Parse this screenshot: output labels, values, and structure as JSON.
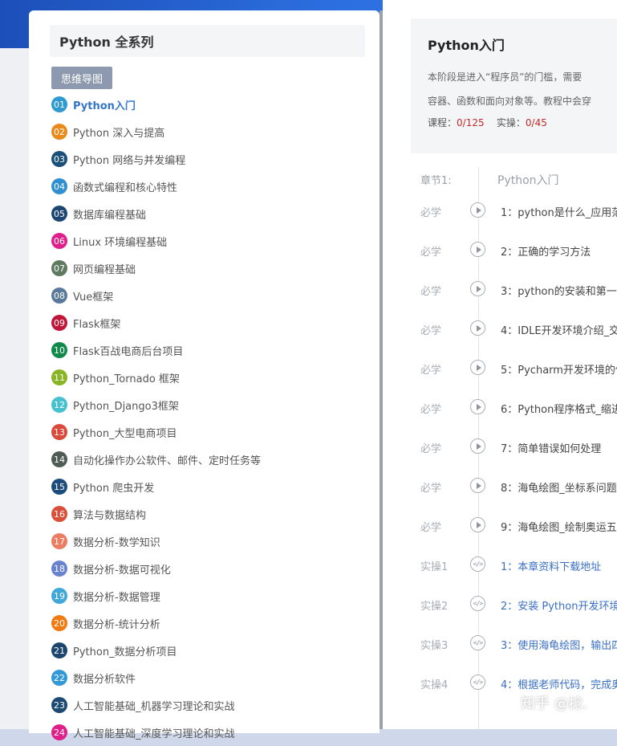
{
  "left": {
    "title": "Python 全系列",
    "mindmap_button": "思维导图",
    "courses": [
      {
        "num": "01",
        "name": "Python入门",
        "color": "#2e9ad0",
        "active": true
      },
      {
        "num": "02",
        "name": "Python 深入与提高",
        "color": "#e98a1d"
      },
      {
        "num": "03",
        "name": "Python 网络与并发编程",
        "color": "#1a4f7a"
      },
      {
        "num": "04",
        "name": "函数式编程和核心特性",
        "color": "#2f8fd0"
      },
      {
        "num": "05",
        "name": "数据库编程基础",
        "color": "#1d4673"
      },
      {
        "num": "06",
        "name": "Linux 环境编程基础",
        "color": "#df1f8a"
      },
      {
        "num": "07",
        "name": "网页编程基础",
        "color": "#5f7a60"
      },
      {
        "num": "08",
        "name": "Vue框架",
        "color": "#5b7a9b"
      },
      {
        "num": "09",
        "name": "Flask框架",
        "color": "#c0153b"
      },
      {
        "num": "10",
        "name": "Flask百战电商后台项目",
        "color": "#0f8a4a"
      },
      {
        "num": "11",
        "name": "Python_Tornado 框架",
        "color": "#88b426"
      },
      {
        "num": "12",
        "name": "Python_Django3框架",
        "color": "#47c1cf"
      },
      {
        "num": "13",
        "name": "Python_大型电商项目",
        "color": "#d94a3a"
      },
      {
        "num": "14",
        "name": "自动化操作办公软件、邮件、定时任务等",
        "color": "#4f5b55"
      },
      {
        "num": "15",
        "name": "Python 爬虫开发",
        "color": "#1b4c7b"
      },
      {
        "num": "16",
        "name": "算法与数据结构",
        "color": "#d9503a"
      },
      {
        "num": "17",
        "name": "数据分析-数学知识",
        "color": "#ea7d62"
      },
      {
        "num": "18",
        "name": "数据分析-数据可视化",
        "color": "#6a83cf"
      },
      {
        "num": "19",
        "name": "数据分析-数据管理",
        "color": "#3fa8d8"
      },
      {
        "num": "20",
        "name": "数据分析-统计分析",
        "color": "#ef7b12"
      },
      {
        "num": "21",
        "name": "Python_数据分析项目",
        "color": "#1c466e"
      },
      {
        "num": "22",
        "name": "数据分析软件",
        "color": "#3399d6"
      },
      {
        "num": "23",
        "name": "人工智能基础_机器学习理论和实战",
        "color": "#1d4a72"
      },
      {
        "num": "24",
        "name": "人工智能基础_深度学习理论和实战",
        "color": "#df1f8a"
      }
    ]
  },
  "right": {
    "title": "Python入门",
    "intro_line1": "本阶段是进入“程序员”的门槛，需要",
    "intro_line2": "容器、函数和面向对象等。教程中会穿",
    "course_label": "课程：",
    "course_value": "0/125",
    "practice_label": "实操：",
    "practice_value": "0/45",
    "chapter_label": "章节1:",
    "chapter_title": "Python入门",
    "lessons": [
      {
        "tag": "必学",
        "title": "1：python是什么_应用范",
        "type": "video"
      },
      {
        "tag": "必学",
        "title": "2：正确的学习方法",
        "type": "video"
      },
      {
        "tag": "必学",
        "title": "3：python的安装和第一行",
        "type": "video"
      },
      {
        "tag": "必学",
        "title": "4：IDLE开发环境介绍_交",
        "type": "video"
      },
      {
        "tag": "必学",
        "title": "5：Pycharm开发环境的使",
        "type": "video"
      },
      {
        "tag": "必学",
        "title": "6：Python程序格式_缩进",
        "type": "video"
      },
      {
        "tag": "必学",
        "title": "7：简单错误如何处理",
        "type": "video"
      },
      {
        "tag": "必学",
        "title": "8：海龟绘图_坐标系问题",
        "type": "video"
      },
      {
        "tag": "必学",
        "title": "9：海龟绘图_绘制奥运五",
        "type": "video"
      },
      {
        "tag": "实操1",
        "title": "1：本章资料下载地址",
        "type": "practice"
      },
      {
        "tag": "实操2",
        "title": "2：安装 Python开发环境",
        "type": "practice"
      },
      {
        "tag": "实操3",
        "title": "3：使用海龟绘图，输出四",
        "type": "practice"
      },
      {
        "tag": "实操4",
        "title": "4：根据老师代码，完成奥",
        "type": "practice"
      }
    ]
  },
  "watermark": "知乎 @捻."
}
